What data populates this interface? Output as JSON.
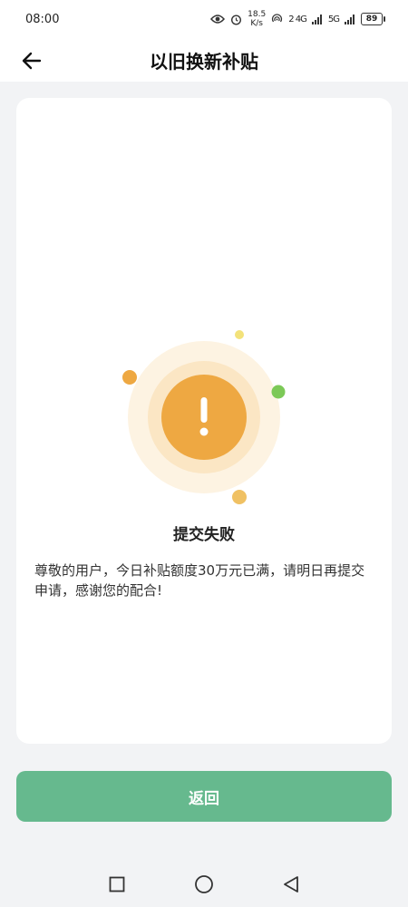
{
  "status_bar": {
    "time": "08:00",
    "speed_value": "18.5",
    "speed_unit": "K/s",
    "signal_1": "2 4G",
    "signal_2": "5G",
    "battery": "89"
  },
  "nav": {
    "title": "以旧换新补贴",
    "back_icon": "arrow-left-icon"
  },
  "result": {
    "status_icon": "exclamation-icon",
    "title": "提交失败",
    "message": "尊敬的用户，今日补贴额度30万元已满，请明日再提交申请，感谢您的配合!",
    "colors": {
      "warning_orange": "#eea842",
      "dot_green": "#7cc957",
      "dot_yellow": "#f3e27a"
    }
  },
  "footer": {
    "return_label": "返回",
    "button_color": "#66b98e"
  },
  "system_nav": {
    "icons": [
      "square-recents-icon",
      "circle-home-icon",
      "triangle-back-icon"
    ]
  }
}
